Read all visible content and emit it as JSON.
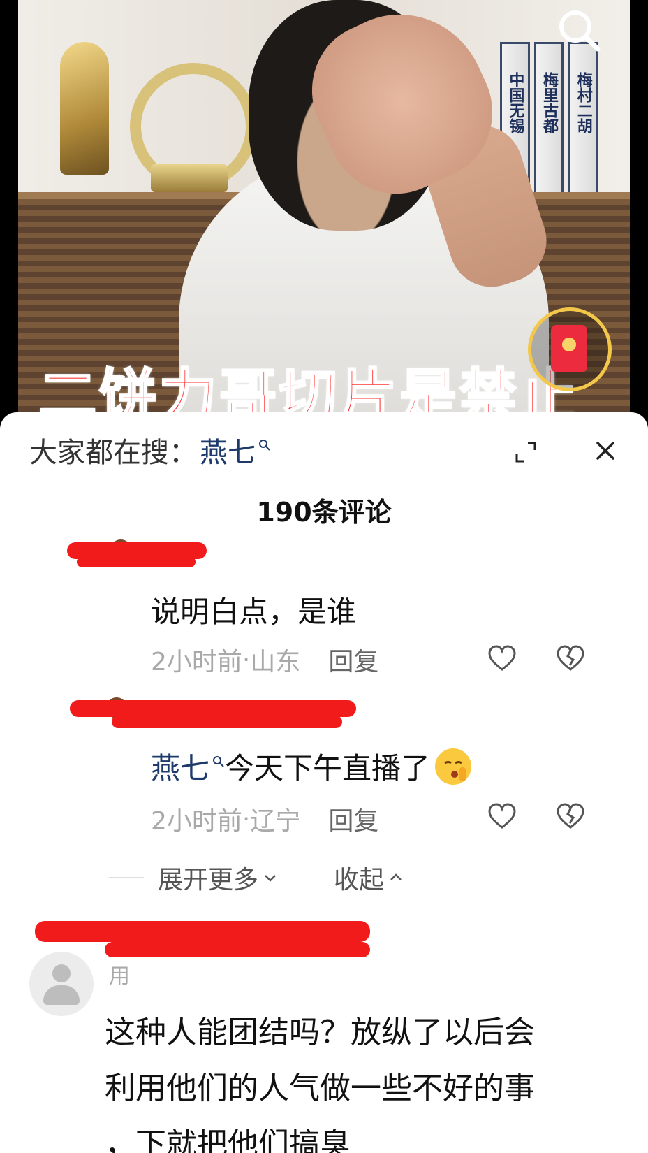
{
  "video": {
    "subtitle": "二饼力哥切片是禁止",
    "book_titles": [
      "中国无锡",
      "梅里古都",
      "梅村二胡"
    ],
    "search_icon": "search-icon",
    "redpacket_icon": "red-envelope-icon"
  },
  "hot_search": {
    "label": "大家都在搜：",
    "keyword": "燕七"
  },
  "comment_count": "190条评论",
  "comments": [
    {
      "text": "说明白点，是谁",
      "time": "2小时前",
      "location": "山东",
      "reply_label": "回复"
    },
    {
      "keyword": "燕七",
      "text": "今天下午直播了",
      "emoji": "shushing-face-emoji",
      "time": "2小时前",
      "location": "辽宁",
      "reply_label": "回复"
    },
    {
      "user_partial": "用",
      "text_lines": [
        "这种人能团结吗？放纵了以后会",
        "利用他们的人气做一些不好的事",
        "，下就把他们搞臭"
      ]
    }
  ],
  "replies_controls": {
    "expand_label": "展开更多",
    "collapse_label": "收起"
  },
  "meta_separator": " · ",
  "colors": {
    "accent_keyword": "#1e3a6b",
    "redaction": "#f21b1b",
    "meta_gray": "#a9a9a9"
  }
}
